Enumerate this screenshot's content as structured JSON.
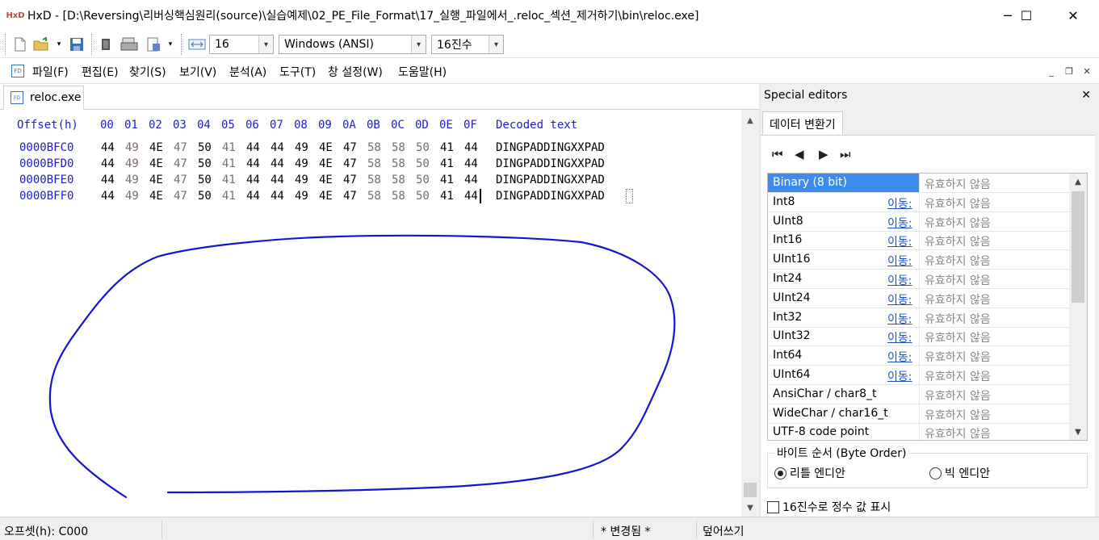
{
  "window": {
    "app_icon": "HxD",
    "title": "HxD - [D:\\Reversing\\리버싱핵심원리(source)\\실습예제\\02_PE_File_Format\\17_실행_파일에서_.reloc_섹션_제거하기\\bin\\reloc.exe]",
    "controls": {
      "minimize": "─",
      "maximize": "☐",
      "close": "✕"
    }
  },
  "toolbar": {
    "icons": [
      "new-file-icon",
      "open-file-icon",
      "save-icon",
      "export-icon",
      "print-icon",
      "properties-icon",
      "bytes-per-row-icon"
    ],
    "bytes_per_row": "16",
    "encoding": "Windows (ANSI)",
    "number_base": "16진수",
    "dropdown_arrow": "▾"
  },
  "menu": {
    "items": [
      "파일(F)",
      "편집(E)",
      "찾기(S)",
      "보기(V)",
      "분석(A)",
      "도구(T)",
      "창 설정(W)",
      "도움말(H)"
    ],
    "mdi": {
      "minimize": "_",
      "restore": "❐",
      "close": "✕"
    }
  },
  "document_tab": {
    "label": "reloc.exe",
    "icon_text": "FD\nHX"
  },
  "hex_view": {
    "header_offset": "Offset(h)",
    "columns": [
      "00",
      "01",
      "02",
      "03",
      "04",
      "05",
      "06",
      "07",
      "08",
      "09",
      "0A",
      "0B",
      "0C",
      "0D",
      "0E",
      "0F"
    ],
    "decoded_header": "Decoded text",
    "rows": [
      {
        "offset": "0000BFC0",
        "bytes": [
          "44",
          "49",
          "4E",
          "47",
          "50",
          "41",
          "44",
          "44",
          "49",
          "4E",
          "47",
          "58",
          "58",
          "50",
          "41",
          "44"
        ],
        "text": "DINGPADDINGXXPAD"
      },
      {
        "offset": "0000BFD0",
        "bytes": [
          "44",
          "49",
          "4E",
          "47",
          "50",
          "41",
          "44",
          "44",
          "49",
          "4E",
          "47",
          "58",
          "58",
          "50",
          "41",
          "44"
        ],
        "text": "DINGPADDINGXXPAD"
      },
      {
        "offset": "0000BFE0",
        "bytes": [
          "44",
          "49",
          "4E",
          "47",
          "50",
          "41",
          "44",
          "44",
          "49",
          "4E",
          "47",
          "58",
          "58",
          "50",
          "41",
          "44"
        ],
        "text": "DINGPADDINGXXPAD"
      },
      {
        "offset": "0000BFF0",
        "bytes": [
          "44",
          "49",
          "4E",
          "47",
          "50",
          "41",
          "44",
          "44",
          "49",
          "4E",
          "47",
          "58",
          "58",
          "50",
          "41",
          "44"
        ],
        "text": "DINGPADDINGXXPAD"
      }
    ],
    "scroll_up": "▲",
    "scroll_down": "▼"
  },
  "special_editors": {
    "title": "Special editors",
    "close": "✕",
    "tab": "데이터 변환기",
    "nav": {
      "first": "⏮",
      "prev": "◀",
      "next": "▶",
      "last": "⏭"
    },
    "rows": [
      {
        "name": "Binary (8 bit)",
        "goto": "",
        "value": "유효하지 않음",
        "selected": true
      },
      {
        "name": "Int8",
        "goto": "이동:",
        "value": "유효하지 않음"
      },
      {
        "name": "UInt8",
        "goto": "이동:",
        "value": "유효하지 않음"
      },
      {
        "name": "Int16",
        "goto": "이동:",
        "value": "유효하지 않음"
      },
      {
        "name": "UInt16",
        "goto": "이동:",
        "value": "유효하지 않음"
      },
      {
        "name": "Int24",
        "goto": "이동:",
        "value": "유효하지 않음"
      },
      {
        "name": "UInt24",
        "goto": "이동:",
        "value": "유효하지 않음"
      },
      {
        "name": "Int32",
        "goto": "이동:",
        "value": "유효하지 않음"
      },
      {
        "name": "UInt32",
        "goto": "이동:",
        "value": "유효하지 않음"
      },
      {
        "name": "Int64",
        "goto": "이동:",
        "value": "유효하지 않음"
      },
      {
        "name": "UInt64",
        "goto": "이동:",
        "value": "유효하지 않음"
      },
      {
        "name": "AnsiChar / char8_t",
        "goto": "",
        "value": "유효하지 않음"
      },
      {
        "name": "WideChar / char16_t",
        "goto": "",
        "value": "유효하지 않음"
      },
      {
        "name": "UTF-8 code point",
        "goto": "",
        "value": "유효하지 않음"
      }
    ],
    "byte_order": {
      "legend": "바이트 순서 (Byte Order)",
      "little": "리틀 엔디안",
      "big": "빅 엔디안",
      "selected": "little"
    },
    "hex_int_checkbox": "16진수로 정수 값 표시",
    "scroll_up": "▲",
    "scroll_down": "▼"
  },
  "status": {
    "offset": "오프셋(h): C000",
    "modified": "* 변경됨 *",
    "mode": "덮어쓰기"
  },
  "annotation": {
    "stroke_color": "#1515d0"
  }
}
